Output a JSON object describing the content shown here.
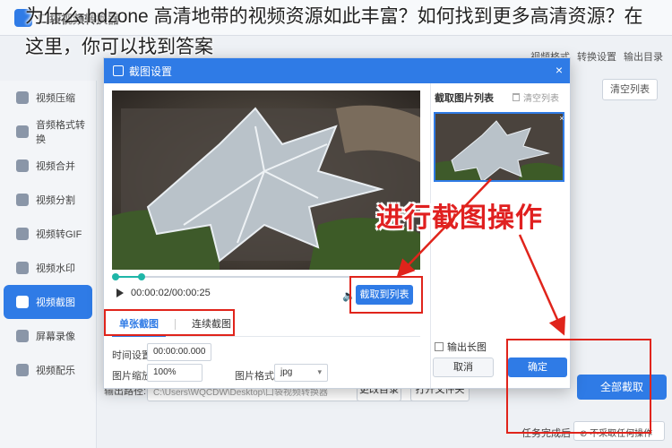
{
  "caption": "为什么 hdzone 高清地带的视频资源如此丰富？如何找到更多高清资源？在这里，你可以找到答案",
  "app": {
    "title": "口袋视频转换器",
    "top_actions": [
      "视频格式",
      "转换设置",
      "输出目录"
    ],
    "sidebar": [
      {
        "label": "视频压缩",
        "icon": "compress-icon",
        "active": false
      },
      {
        "label": "音频格式转换",
        "icon": "audio-icon",
        "active": false
      },
      {
        "label": "视频合并",
        "icon": "merge-icon",
        "active": false
      },
      {
        "label": "视频分割",
        "icon": "split-icon",
        "active": false
      },
      {
        "label": "视频转GIF",
        "icon": "gif-icon",
        "active": false
      },
      {
        "label": "视频水印",
        "icon": "watermark-icon",
        "active": false
      },
      {
        "label": "视频截图",
        "icon": "screenshot-icon",
        "active": true
      },
      {
        "label": "屏幕录像",
        "icon": "record-icon",
        "active": false
      },
      {
        "label": "视频配乐",
        "icon": "music-icon",
        "active": false
      }
    ],
    "clear_list": "清空列表",
    "output_label": "输出路径:",
    "output_path": "C:\\Users\\WQCDW\\Desktop\\口袋视频转换器",
    "change_dir": "更改目录",
    "open_folder": "打开文件夹",
    "convert_all": "全部截取",
    "done_label": "任务完成后",
    "done_option": "不采取任何操作"
  },
  "dialog": {
    "title": "截图设置",
    "close": "×",
    "timecode": "00:00:02/00:00:25",
    "progress": 0.08,
    "grab_button": "截取到列表",
    "tabs": [
      "单张截图",
      "连续截图"
    ],
    "active_tab": 0,
    "time_label": "时间设置:",
    "time_value": "00:00:00.000",
    "scale_label": "图片缩放:",
    "scale_value": "100%",
    "format_label": "图片格式:",
    "format_value": "jpg",
    "list_title": "截取图片列表",
    "list_clear": "清空列表",
    "long_image": "输出长图",
    "cancel": "取消",
    "ok": "确定"
  },
  "annotation": {
    "text": "进行截图操作",
    "color": "#e0241b"
  },
  "colors": {
    "accent": "#2f7be6",
    "timeline": "#1fb6a8"
  }
}
